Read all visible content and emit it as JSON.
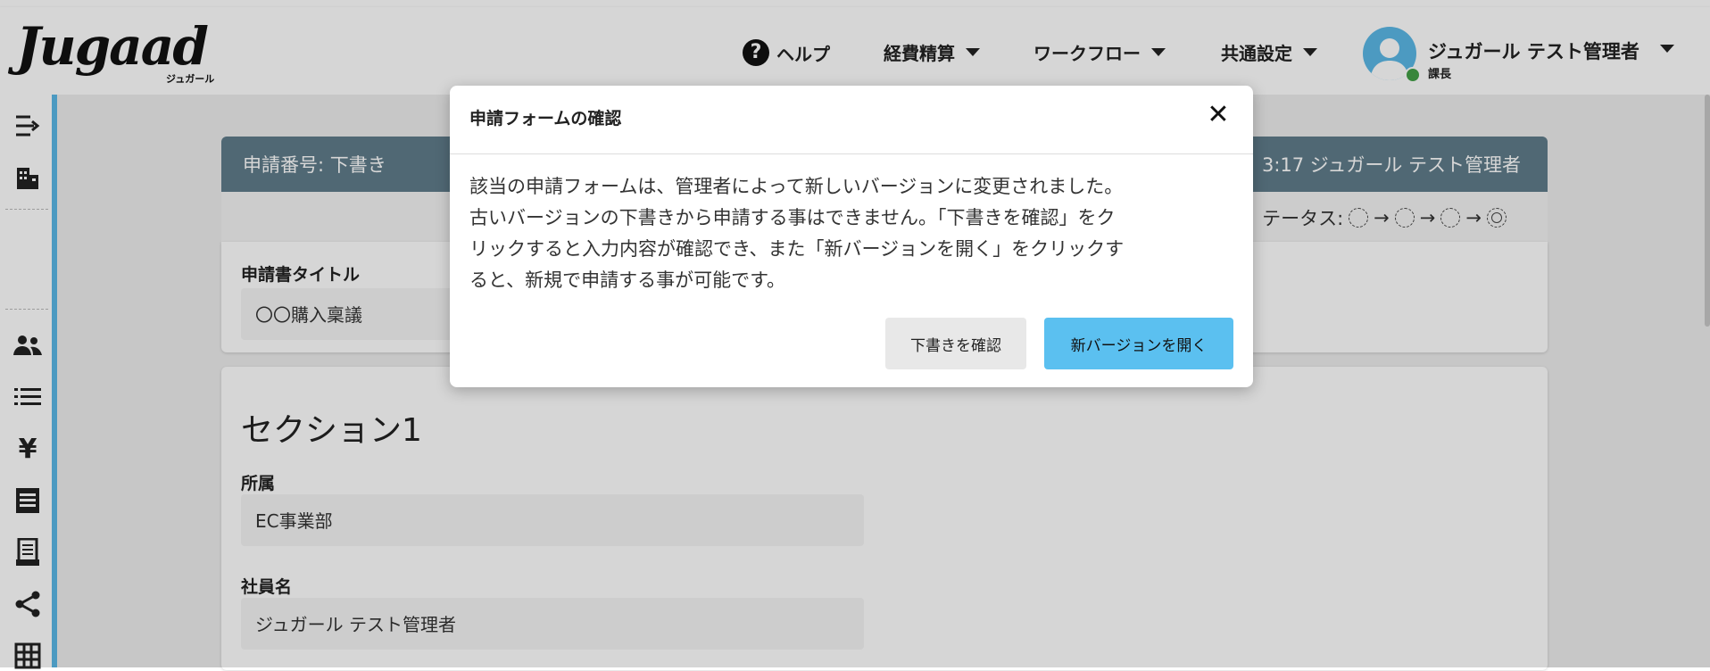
{
  "app": {
    "logo": "Jugaad",
    "logo_sub": "ジュガール"
  },
  "nav": {
    "help": "ヘルプ",
    "expense": "経費精算",
    "workflow": "ワークフロー",
    "common": "共通設定"
  },
  "user": {
    "name": "ジュガール テスト管理者",
    "role": "課長",
    "status_color": "#43a047"
  },
  "colors": {
    "accent": "#5bb8e6",
    "header_bar": "#607d8b",
    "primary_button": "#5bc0f0"
  },
  "sidebar": {
    "icons": [
      "menu-expand-icon",
      "building-icon",
      "people-icon",
      "list-icon",
      "yen-icon",
      "document-icon",
      "receipt-icon",
      "share-icon",
      "grid-icon"
    ]
  },
  "card": {
    "header_left": "申請番号: 下書き",
    "header_right": "3:17  ジュガール テスト管理者",
    "status_label": "テータス:"
  },
  "form": {
    "title_label": "申請書タイトル",
    "title_value": "〇〇購入稟議",
    "section_title": "セクション1",
    "dept_label": "所属",
    "dept_value": "EC事業部",
    "employee_label": "社員名",
    "employee_value": "ジュガール テスト管理者"
  },
  "modal": {
    "title": "申請フォームの確認",
    "close": "✕",
    "line1": "該当の申請フォームは、管理者によって新しいバージョンに変更されました。",
    "line2": "古いバージョンの下書きから申請する事はできません。「下書きを確認」をク",
    "line3": "リックすると入力内容が確認でき、また「新バージョンを開く」をクリックす",
    "line4": "ると、新規で申請する事が可能です。",
    "secondary_button": "下書きを確認",
    "primary_button": "新バージョンを開く"
  }
}
